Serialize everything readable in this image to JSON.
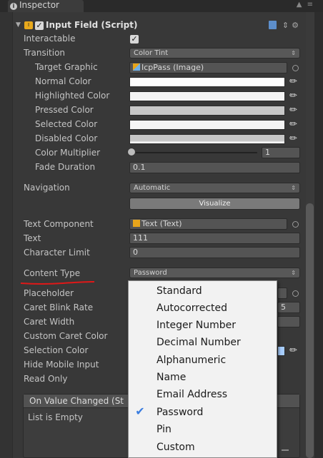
{
  "window": {
    "tab_title": "Inspector",
    "tab_controls": "▲ ≡"
  },
  "component": {
    "title": "Input Field (Script)",
    "enabled": true,
    "icon": "input-field-icon",
    "header_icons": [
      "book-icon",
      "sliders-icon",
      "gear-icon"
    ]
  },
  "props": {
    "interactable": {
      "label": "Interactable",
      "checked": true
    },
    "transition": {
      "label": "Transition",
      "value": "Color Tint"
    },
    "target_graphic": {
      "label": "Target Graphic",
      "value": "IcpPass (Image)"
    },
    "normal_color": {
      "label": "Normal Color",
      "color": "#FFFFFF"
    },
    "highlighted_color": {
      "label": "Highlighted Color",
      "color": "#F5F5F5"
    },
    "pressed_color": {
      "label": "Pressed Color",
      "color": "#C8C8C8"
    },
    "selected_color": {
      "label": "Selected Color",
      "color": "#F5F5F5"
    },
    "disabled_color": {
      "label": "Disabled Color",
      "color": "#C8C8C8"
    },
    "color_multiplier": {
      "label": "Color Multiplier",
      "value": "1",
      "slider_fraction": 0.0
    },
    "fade_duration": {
      "label": "Fade Duration",
      "value": "0.1"
    },
    "navigation": {
      "label": "Navigation",
      "value": "Automatic"
    },
    "visualize": {
      "label": "Visualize"
    },
    "text_component": {
      "label": "Text Component",
      "value": "Text (Text)"
    },
    "text": {
      "label": "Text",
      "value": "111"
    },
    "character_limit": {
      "label": "Character Limit",
      "value": "0"
    },
    "content_type": {
      "label": "Content Type",
      "value": "Password"
    },
    "placeholder": {
      "label": "Placeholder"
    },
    "caret_blink_rate": {
      "label": "Caret Blink Rate",
      "value_tail": "5"
    },
    "caret_width": {
      "label": "Caret Width"
    },
    "custom_caret_color": {
      "label": "Custom Caret Color"
    },
    "selection_color": {
      "label": "Selection Color",
      "color": "#A8CEFF"
    },
    "hide_mobile_input": {
      "label": "Hide Mobile Input"
    },
    "read_only": {
      "label": "Read Only"
    }
  },
  "event": {
    "title": "On Value Changed (St",
    "empty_text": "List is Empty"
  },
  "dropdown": {
    "options": [
      "Standard",
      "Autocorrected",
      "Integer Number",
      "Decimal Number",
      "Alphanumeric",
      "Name",
      "Email Address",
      "Password",
      "Pin",
      "Custom"
    ],
    "selected_index": 7,
    "selected_value": "Password"
  },
  "colors": {
    "annotation_underline": "#E01818",
    "check_accent": "#3A7DE0"
  }
}
